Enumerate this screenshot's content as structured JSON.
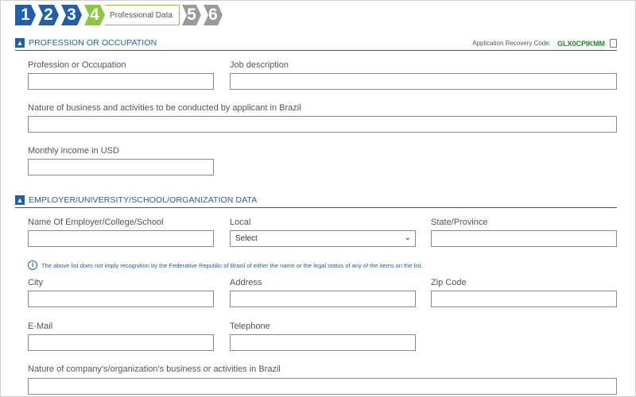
{
  "steps": {
    "s1": "1",
    "s2": "2",
    "s3": "3",
    "s4": "4",
    "current_label": "Professional Data",
    "s5": "5",
    "s6": "6"
  },
  "section_profession": {
    "title": "PROFESSION OR OCCUPATION",
    "recovery_label": "Application Recovery Code:",
    "recovery_code": "GLX0CPIKMM"
  },
  "profession_fields": {
    "occupation_label": "Profession or Occupation",
    "job_description_label": "Job description",
    "nature_business_label": "Nature of business and activities to be conducted by applicant in Brazil",
    "monthly_income_label": "Monthly income in USD"
  },
  "section_employer": {
    "title": "EMPLOYER/UNIVERSITY/SCHOOL/ORGANIZATION DATA"
  },
  "employer_fields": {
    "employer_name_label": "Name Of Employer/College/School",
    "local_label": "Local",
    "local_value": "Select",
    "state_label": "State/Province",
    "notice": "The above list does not imply recognition by the Federative Republic of Brazil of either the name or the legal status of any of the items on the list.",
    "city_label": "City",
    "address_label": "Address",
    "zip_label": "Zip Code",
    "email_label": "E-Mail",
    "telephone_label": "Telephone",
    "company_nature_label": "Nature of company's/organization's business or activities in Brazil"
  }
}
